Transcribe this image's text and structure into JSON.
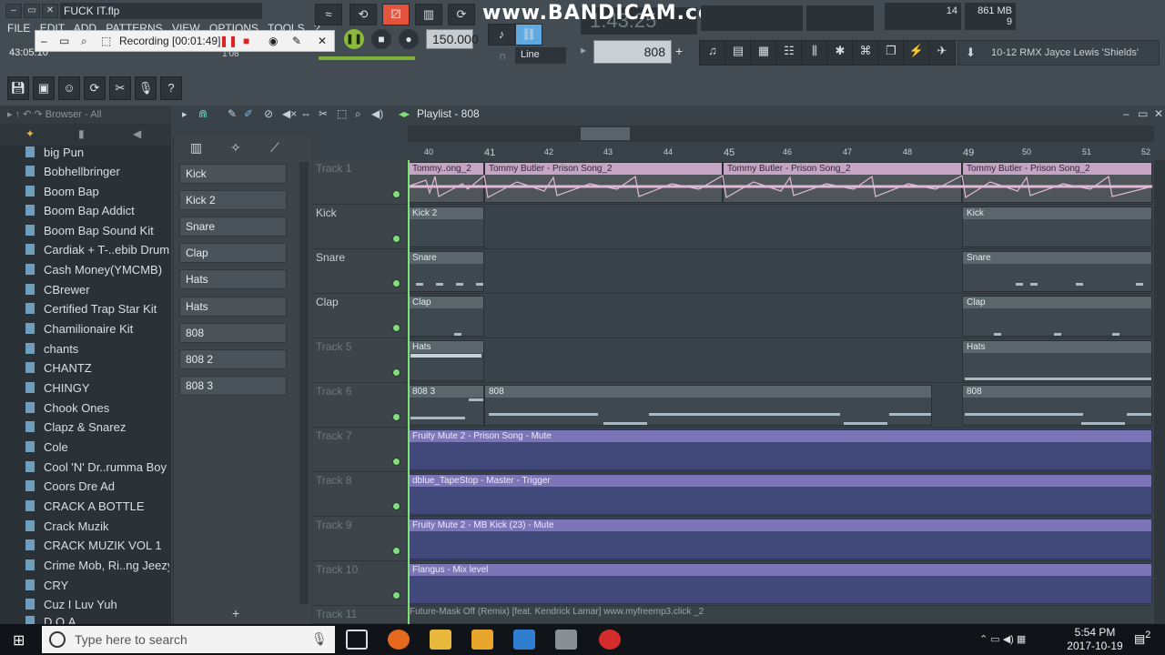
{
  "app": {
    "file_name": "FUCK IT.flp",
    "menu": [
      "FILE",
      "EDIT",
      "ADD",
      "PATTERNS",
      "VIEW",
      "OPTIONS",
      "TOOLS",
      "?"
    ],
    "song_time": "43:05:10",
    "big_time": "1:43:25",
    "tempo": "150.000",
    "pattern_name": "808",
    "snap_mode": "Line",
    "cpu": "14",
    "memory": "861 MB",
    "voices": "9",
    "hint_text": "10-12  RMX Jayce Lewis 'Shields'",
    "counter": "1'08"
  },
  "recording": {
    "label": "Recording [00:01:49]",
    "watermark": "www.BANDICAM.com"
  },
  "browser": {
    "header": "Browser - All",
    "items": [
      "big Pun",
      "Bobhellbringer",
      "Boom Bap",
      "Boom Bap Addict",
      "Boom Bap Sound Kit",
      "Cardiak + T-..ebib Drumkit",
      "Cash Money(YMCMB)",
      "CBrewer",
      "Certified Trap Star Kit",
      "Chamilionaire Kit",
      "chants",
      "CHANTZ",
      "CHINGY",
      "Chook Ones",
      "Clapz & Snarez",
      "Cole",
      "Cool 'N' Dr..rumma Boy Kit",
      "Coors Dre Ad",
      "CRACK A BOTTLE",
      "Crack Muzik",
      "CRACK MUZIK VOL 1",
      "Crime Mob, Ri..ng Jeezy Kit",
      "CRY",
      "Cuz I Luv Yuh",
      "D.O.A."
    ]
  },
  "channel_rack": {
    "channels": [
      "Kick",
      "Kick 2",
      "Snare",
      "Clap",
      "Hats",
      "Hats",
      "808",
      "808 2",
      "808 3"
    ],
    "add_label": "+"
  },
  "playlist": {
    "title": "Playlist - 808",
    "bars": [
      "40",
      "41",
      "42",
      "43",
      "44",
      "45",
      "46",
      "47",
      "48",
      "49",
      "50",
      "51",
      "52"
    ],
    "tracks": [
      "Track 1",
      "Kick",
      "Snare",
      "Clap",
      "Track 5",
      "Track 6",
      "Track 7",
      "Track 8",
      "Track 9",
      "Track 10",
      "Track 11"
    ],
    "audio_clips": [
      "Tommy..ong_2",
      "Tommy Butler - Prison Song_2",
      "Tommy Butler - Prison Song_2",
      "Tommy Butler - Prison Song_2"
    ],
    "pattern_clips": {
      "kick": [
        "Kick 2",
        "Kick"
      ],
      "snare": [
        "Snare",
        "Snare"
      ],
      "clap": [
        "Clap",
        "Clap"
      ],
      "hats": [
        "Hats",
        "Hats"
      ],
      "t6": [
        "808 3",
        "808",
        "808"
      ]
    },
    "automation_clips": [
      "Fruity Mute 2 - Prison Song - Mute",
      "dblue_TapeStop - Master - Trigger",
      "Fruity Mute 2 - MB Kick (23) - Mute",
      "Flangus - Mix level"
    ],
    "bottom_clip": "Future-Mask Off (Remix) [feat. Kendrick Lamar] www.myfreemp3.click _2"
  },
  "taskbar": {
    "search_placeholder": "Type here to search",
    "time": "5:54 PM",
    "date": "2017-10-19",
    "notifications": "2"
  }
}
